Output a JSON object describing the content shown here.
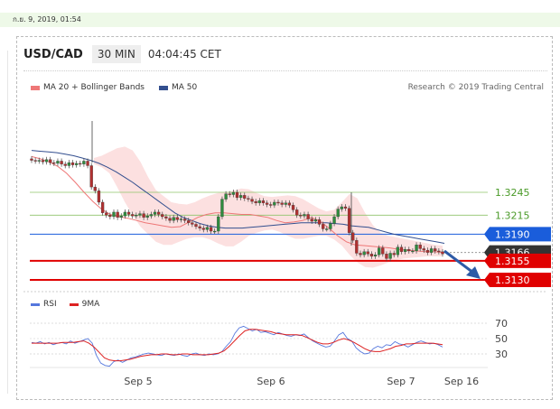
{
  "timestamp": "ก.ย. 9, 2019, 01:54",
  "header": {
    "pair": "USD/CAD",
    "period": "30 MIN",
    "time": "04:04:45 CET"
  },
  "legend": {
    "ma20": "MA 20 + Bollinger Bands",
    "ma50": "MA 50",
    "credit": "Research © 2019 Trading Central"
  },
  "rsi_legend": {
    "rsi": "RSI",
    "ma9": "9MA"
  },
  "colors": {
    "ma20": "#ee7777",
    "ma50": "#334f8f",
    "band": "#fbd8d8",
    "support": "#e00000",
    "pivot": "#1a5ddb",
    "resistance": "#8fc46a",
    "current": "#333333",
    "rsi": "#5577dd",
    "rsi_ma": "#dd2222"
  },
  "chart_data": [
    {
      "type": "candlestick",
      "title": "USD/CAD",
      "x_tick_labels": [
        "Sep 5",
        "Sep 6",
        "Sep 7",
        "Sep 16"
      ],
      "ylim": [
        1.3115,
        1.3305
      ],
      "levels": [
        {
          "value": 1.3245,
          "label": "1.3245",
          "kind": "resistance"
        },
        {
          "value": 1.3215,
          "label": "1.3215",
          "kind": "resistance"
        },
        {
          "value": 1.319,
          "label": "1.3190",
          "kind": "pivot"
        },
        {
          "value": 1.3166,
          "label": "1.3166",
          "kind": "current"
        },
        {
          "value": 1.3155,
          "label": "1.3155",
          "kind": "support"
        },
        {
          "value": 1.313,
          "label": "1.3130",
          "kind": "support"
        }
      ],
      "close": [
        1.3287,
        1.3286,
        1.3287,
        1.3285,
        1.3288,
        1.3284,
        1.3283,
        1.3286,
        1.3282,
        1.328,
        1.3284,
        1.3281,
        1.3283,
        1.3282,
        1.3286,
        1.328,
        1.3252,
        1.3247,
        1.3232,
        1.3218,
        1.3215,
        1.3213,
        1.3219,
        1.3212,
        1.3214,
        1.3219,
        1.3216,
        1.3214,
        1.3215,
        1.3217,
        1.3212,
        1.3214,
        1.3216,
        1.3219,
        1.3216,
        1.3213,
        1.3211,
        1.3208,
        1.3212,
        1.3209,
        1.321,
        1.3208,
        1.3205,
        1.3203,
        1.32,
        1.3198,
        1.3196,
        1.3199,
        1.3194,
        1.3194,
        1.3213,
        1.3236,
        1.3243,
        1.3242,
        1.3245,
        1.3238,
        1.3241,
        1.3237,
        1.3236,
        1.3233,
        1.3231,
        1.3234,
        1.3231,
        1.3229,
        1.3228,
        1.3232,
        1.3231,
        1.3229,
        1.3231,
        1.3228,
        1.3222,
        1.3215,
        1.3214,
        1.3216,
        1.321,
        1.3207,
        1.3209,
        1.3203,
        1.3197,
        1.3197,
        1.3204,
        1.3213,
        1.3223,
        1.3226,
        1.3224,
        1.3192,
        1.3182,
        1.3165,
        1.3163,
        1.3167,
        1.3164,
        1.3161,
        1.3163,
        1.3172,
        1.3164,
        1.3158,
        1.3165,
        1.3163,
        1.3173,
        1.3167,
        1.317,
        1.3168,
        1.3168,
        1.3176,
        1.3171,
        1.3169,
        1.3166,
        1.3171,
        1.3168,
        1.3167,
        1.3164
      ],
      "ma50": [
        1.33,
        1.3299,
        1.3298,
        1.3297,
        1.3295,
        1.3293,
        1.329,
        1.3287,
        1.3283,
        1.3278,
        1.3272,
        1.3265,
        1.3258,
        1.325,
        1.3242,
        1.3234,
        1.3226,
        1.3218,
        1.3212,
        1.3208,
        1.3204,
        1.3201,
        1.3199,
        1.3198,
        1.3198,
        1.3198,
        1.3199,
        1.32,
        1.3201,
        1.3202,
        1.3203,
        1.3204,
        1.3205,
        1.3205,
        1.3205,
        1.3205,
        1.3204,
        1.3203,
        1.3201,
        1.32,
        1.3199,
        1.3196,
        1.3193,
        1.319,
        1.3188,
        1.3186,
        1.3184,
        1.3182,
        1.318,
        1.3178
      ],
      "ma20": [
        1.3292,
        1.3289,
        1.3285,
        1.3279,
        1.327,
        1.3258,
        1.3245,
        1.3233,
        1.3223,
        1.3216,
        1.3213,
        1.3211,
        1.3208,
        1.3205,
        1.3203,
        1.3201,
        1.3199,
        1.32,
        1.3206,
        1.3212,
        1.3216,
        1.3218,
        1.3218,
        1.3217,
        1.3216,
        1.3216,
        1.3214,
        1.3212,
        1.3208,
        1.3205,
        1.3206,
        1.3208,
        1.3212,
        1.3207,
        1.3198,
        1.3188,
        1.318,
        1.3176,
        1.3175,
        1.3174,
        1.3173,
        1.3172,
        1.317,
        1.3169,
        1.3168,
        1.3167,
        1.3167,
        1.3166
      ],
      "bollinger_upper": [
        1.329,
        1.3293,
        1.3298,
        1.3303,
        1.3305,
        1.33,
        1.3285,
        1.3265,
        1.3248,
        1.324,
        1.3232,
        1.323,
        1.3229,
        1.3232,
        1.3237,
        1.3241,
        1.3244,
        1.3245,
        1.3247,
        1.325,
        1.3249,
        1.3244,
        1.324,
        1.3239,
        1.324,
        1.3241,
        1.324,
        1.3236,
        1.323,
        1.3224,
        1.322,
        1.3222,
        1.3232,
        1.3243,
        1.3237,
        1.3218,
        1.3202,
        1.3192,
        1.3188,
        1.3186,
        1.3184,
        1.3182,
        1.318,
        1.3178,
        1.3176,
        1.3175
      ],
      "bollinger_lower": [
        1.3282,
        1.3278,
        1.327,
        1.3252,
        1.3232,
        1.3215,
        1.32,
        1.319,
        1.318,
        1.3176,
        1.3176,
        1.318,
        1.3184,
        1.3186,
        1.3186,
        1.3183,
        1.3178,
        1.3174,
        1.3174,
        1.318,
        1.3188,
        1.3192,
        1.3195,
        1.3196,
        1.3193,
        1.3188,
        1.3184,
        1.3184,
        1.3186,
        1.3188,
        1.3188,
        1.3183,
        1.3175,
        1.3163,
        1.3153,
        1.3147,
        1.3146,
        1.3149,
        1.3153,
        1.3156,
        1.3158,
        1.3159,
        1.316,
        1.3161,
        1.3161,
        1.3161
      ]
    },
    {
      "type": "line",
      "title": "RSI",
      "series_names": [
        "RSI",
        "9MA"
      ],
      "x_tick_labels": [
        "Sep 5",
        "Sep 6",
        "Sep 7",
        "Sep 16"
      ],
      "y_tick_labels": [
        "70",
        "50",
        "30"
      ],
      "ylim": [
        10,
        80
      ],
      "rsi": [
        45,
        44,
        46,
        43,
        45,
        42,
        44,
        45,
        43,
        47,
        44,
        46,
        48,
        50,
        44,
        28,
        18,
        15,
        14,
        20,
        22,
        19,
        22,
        25,
        26,
        28,
        30,
        31,
        30,
        29,
        28,
        30,
        29,
        28,
        30,
        28,
        27,
        30,
        31,
        29,
        28,
        30,
        29,
        30,
        33,
        40,
        46,
        57,
        64,
        66,
        63,
        60,
        62,
        58,
        59,
        57,
        55,
        58,
        56,
        54,
        53,
        55,
        54,
        56,
        51,
        47,
        44,
        41,
        39,
        40,
        47,
        55,
        58,
        50,
        47,
        38,
        33,
        30,
        31,
        37,
        40,
        38,
        42,
        41,
        46,
        43,
        42,
        39,
        42,
        45,
        47,
        45,
        43,
        44,
        42,
        39
      ],
      "ma9": [
        44,
        44,
        44,
        44,
        44,
        44,
        45,
        45,
        45,
        46,
        47,
        44,
        39,
        32,
        25,
        22,
        21,
        21,
        22,
        23,
        25,
        27,
        28,
        29,
        29,
        30,
        30,
        29,
        29,
        30,
        30,
        29,
        29,
        29,
        29,
        30,
        31,
        34,
        40,
        47,
        54,
        60,
        62,
        62,
        61,
        60,
        59,
        57,
        56,
        55,
        55,
        55,
        54,
        51,
        48,
        45,
        43,
        43,
        45,
        48,
        50,
        48,
        45,
        41,
        37,
        34,
        33,
        33,
        35,
        37,
        40,
        41,
        43,
        43,
        44,
        44,
        44,
        44,
        43,
        42
      ]
    }
  ]
}
